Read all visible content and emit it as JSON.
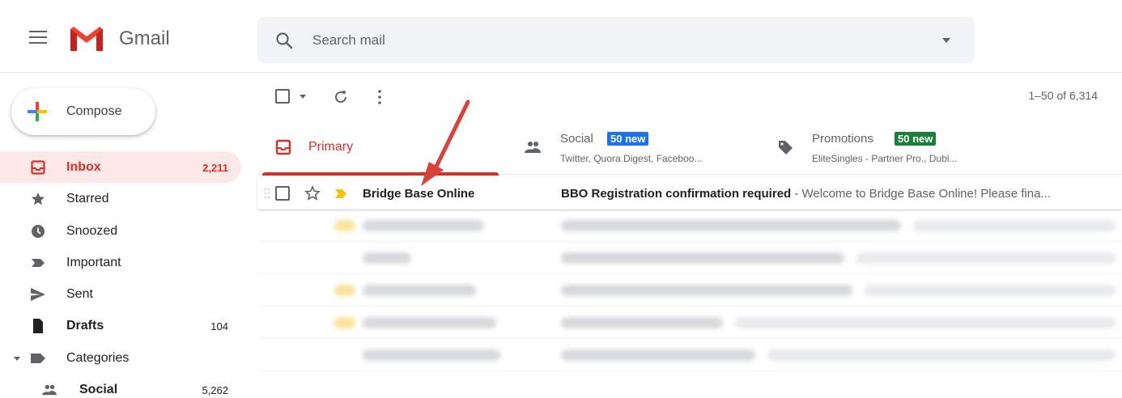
{
  "header": {
    "brand": "Gmail",
    "search_placeholder": "Search mail"
  },
  "sidebar": {
    "compose_label": "Compose",
    "items": [
      {
        "label": "Inbox",
        "count": "2,211",
        "icon": "inbox-icon"
      },
      {
        "label": "Starred",
        "count": "",
        "icon": "star-icon"
      },
      {
        "label": "Snoozed",
        "count": "",
        "icon": "clock-icon"
      },
      {
        "label": "Important",
        "count": "",
        "icon": "important-icon"
      },
      {
        "label": "Sent",
        "count": "",
        "icon": "send-icon"
      },
      {
        "label": "Drafts",
        "count": "104",
        "icon": "draft-icon"
      },
      {
        "label": "Categories",
        "count": "",
        "icon": "label-icon"
      },
      {
        "label": "Social",
        "count": "5,262",
        "icon": "people-icon"
      }
    ]
  },
  "toolbar": {
    "pager": "1–50 of 6,314"
  },
  "tabs": {
    "primary": {
      "label": "Primary"
    },
    "social": {
      "label": "Social",
      "badge": "50 new",
      "subtitle": "Twitter, Quora Digest, Faceboo..."
    },
    "promotions": {
      "label": "Promotions",
      "badge": "50 new",
      "subtitle": "EliteSingles - Partner Pro., Dubl..."
    }
  },
  "emails": [
    {
      "sender": "Bridge Base Online",
      "subject": "BBO Registration confirmation required",
      "snippet": " - Welcome to Bridge Base Online! Please fina..."
    }
  ],
  "colors": {
    "accent_red": "#d93025",
    "social_badge": "#1a73e8",
    "promotions_badge": "#188038",
    "important_marker": "#f4c20d"
  }
}
